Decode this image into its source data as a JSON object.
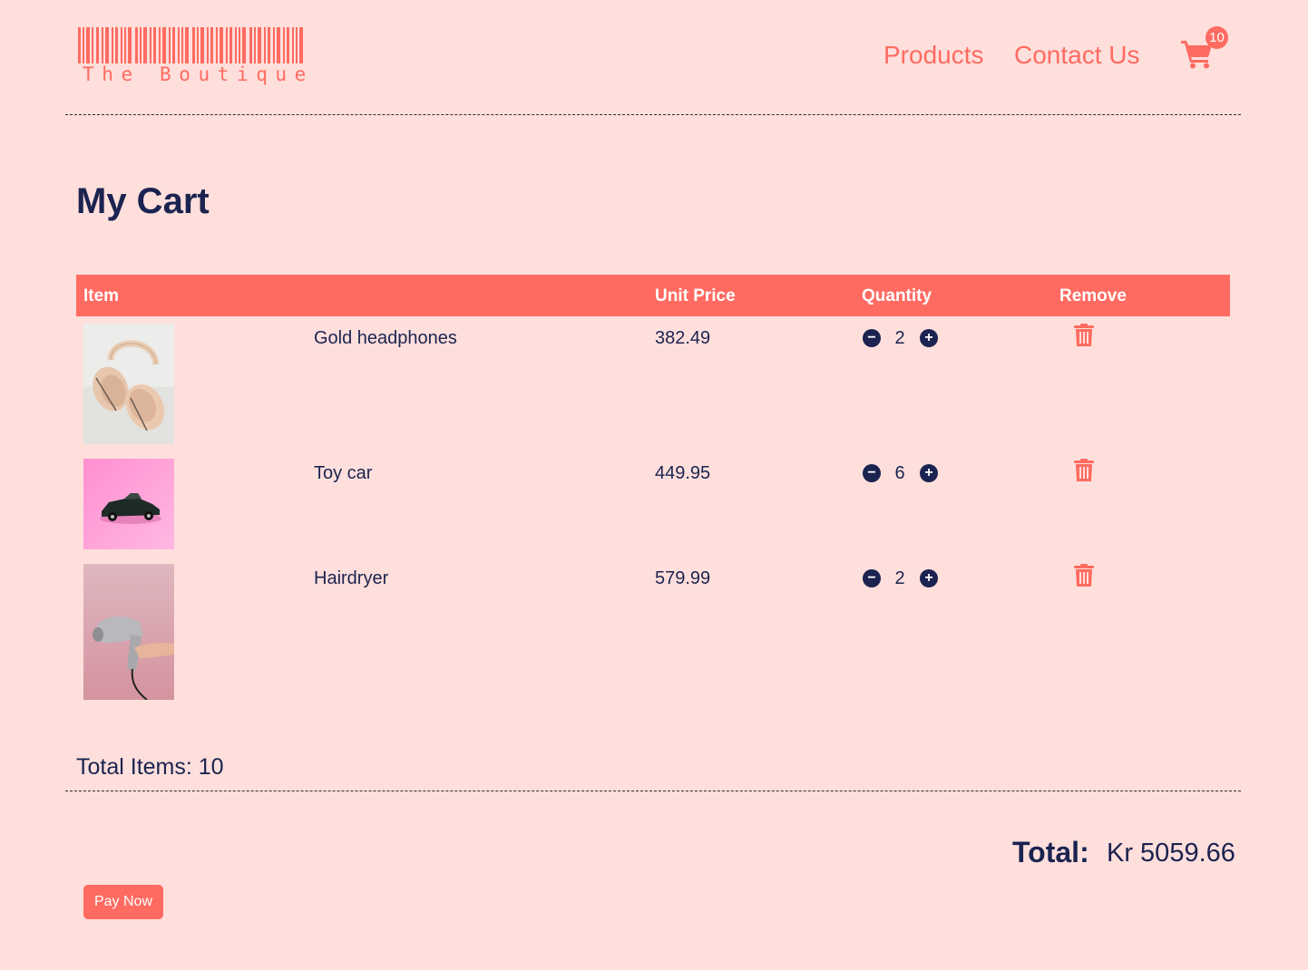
{
  "brand": {
    "logo_text": "The Boutique",
    "accent_color": "#ff6b61",
    "text_color": "#1b2350",
    "background_color": "#ffdfdc"
  },
  "nav": {
    "products_label": "Products",
    "contact_label": "Contact Us",
    "cart_icon": "shopping-cart-icon",
    "cart_count": "10"
  },
  "page": {
    "title": "My Cart"
  },
  "table": {
    "headers": {
      "item": "Item",
      "unit_price": "Unit Price",
      "quantity": "Quantity",
      "remove": "Remove"
    },
    "rows": [
      {
        "name": "Gold headphones",
        "price": "382.49",
        "quantity": "2",
        "image": "headphones-image"
      },
      {
        "name": "Toy car",
        "price": "449.95",
        "quantity": "6",
        "image": "toy-car-image"
      },
      {
        "name": "Hairdryer",
        "price": "579.99",
        "quantity": "2",
        "image": "hairdryer-image"
      }
    ],
    "minus_icon": "minus-circle-icon",
    "plus_icon": "plus-circle-icon",
    "remove_icon": "trash-icon"
  },
  "summary": {
    "total_items_label": "Total Items:",
    "total_items_value": "10",
    "total_label": "Total:",
    "total_amount": "Kr 5059.66",
    "pay_button": "Pay Now"
  }
}
